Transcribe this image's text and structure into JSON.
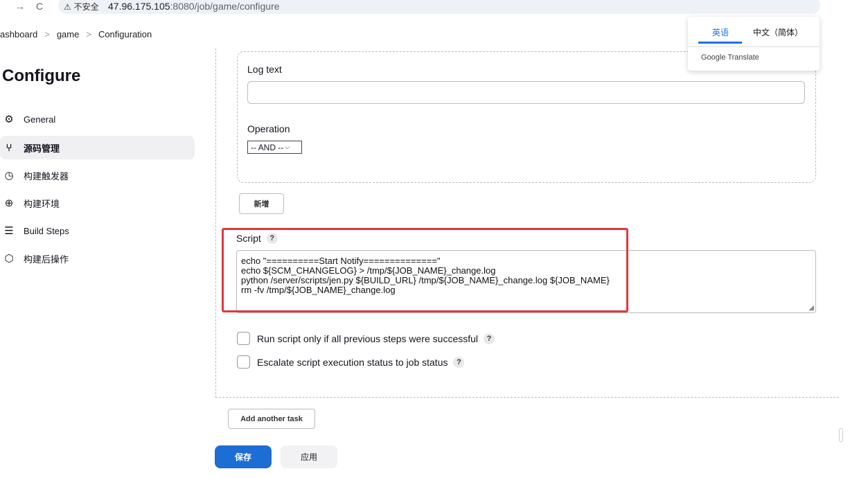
{
  "browser": {
    "back_icon": "→",
    "reload_icon": "C",
    "security_label": "⚠ 不安全",
    "url_host": "47.96.175.105",
    "url_port_path": ":8080/job/game/configure"
  },
  "breadcrumb": {
    "items": [
      "ashboard",
      "game",
      "Configuration"
    ],
    "separator": ">"
  },
  "sidebar": {
    "title": "Configure",
    "items": [
      {
        "label": "General",
        "icon": "gear-icon",
        "glyph": "⚙"
      },
      {
        "label": "源码管理",
        "icon": "branch-icon",
        "glyph": "⑂"
      },
      {
        "label": "构建触发器",
        "icon": "clock-icon",
        "glyph": "◷"
      },
      {
        "label": "构建环境",
        "icon": "globe-icon",
        "glyph": "⊕"
      },
      {
        "label": "Build Steps",
        "icon": "list-icon",
        "glyph": "☰"
      },
      {
        "label": "构建后操作",
        "icon": "package-icon",
        "glyph": "⬡"
      }
    ]
  },
  "form": {
    "log_text_label": "Log text",
    "log_text_value": "",
    "operation_label": "Operation",
    "operation_selected": "-- AND --",
    "add_button": "新增",
    "script_label": "Script",
    "help_glyph": "?",
    "script_lines": [
      "echo \"==========Start Notify==============\"",
      "echo ${SCM_CHANGELOG} > /tmp/${JOB_NAME}_change.log",
      "python /server/scripts/jen.py ${BUILD_URL} /tmp/${JOB_NAME}_change.log ${JOB_NAME}",
      "rm -fv /tmp/${JOB_NAME}_change.log"
    ],
    "checkbox_1": "Run script only if all previous steps were successful",
    "checkbox_2": "Escalate script execution status to job status",
    "add_task_button": "Add another task"
  },
  "footer": {
    "save_label": "保存",
    "apply_label": "应用"
  },
  "translate_popup": {
    "tab_english": "英语",
    "tab_chinese": "中文（简体）",
    "brand": "Google Translate"
  },
  "colors": {
    "primary": "#1c6dd4",
    "highlight_box": "#e0373d",
    "translate_accent": "#1a73e8"
  }
}
